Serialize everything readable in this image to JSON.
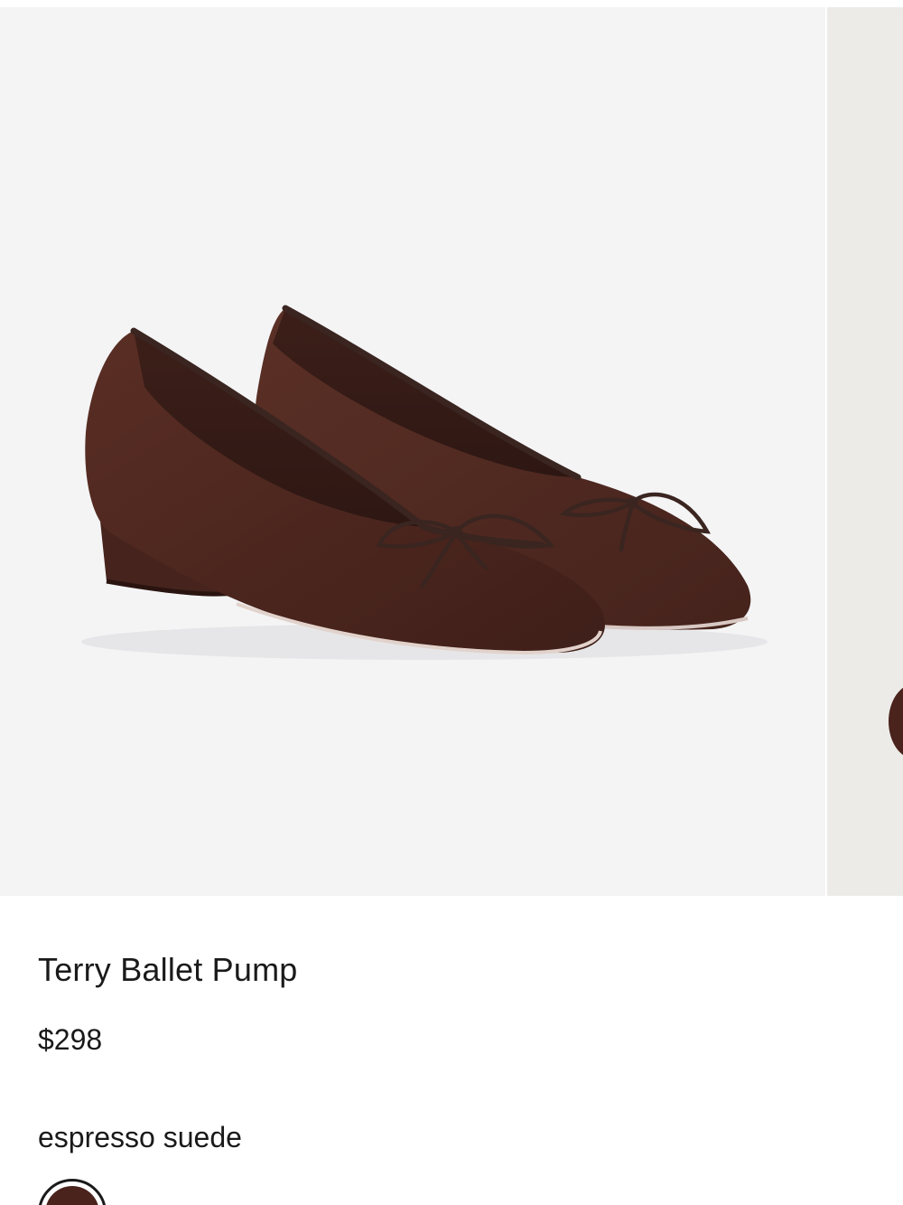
{
  "product": {
    "title": "Terry Ballet Pump",
    "price": "$298",
    "selected_color": "espresso suede"
  },
  "gallery": {
    "images": [
      {
        "name": "product-image-pair",
        "description_icon": "shoe-pair-image"
      },
      {
        "name": "product-image-next",
        "description_icon": "shoe-partial-image"
      }
    ]
  },
  "colors": {
    "background": "#f4f4f5",
    "suede": "#4a231c",
    "trim": "#3a2520",
    "swatch": "#4a231c"
  }
}
